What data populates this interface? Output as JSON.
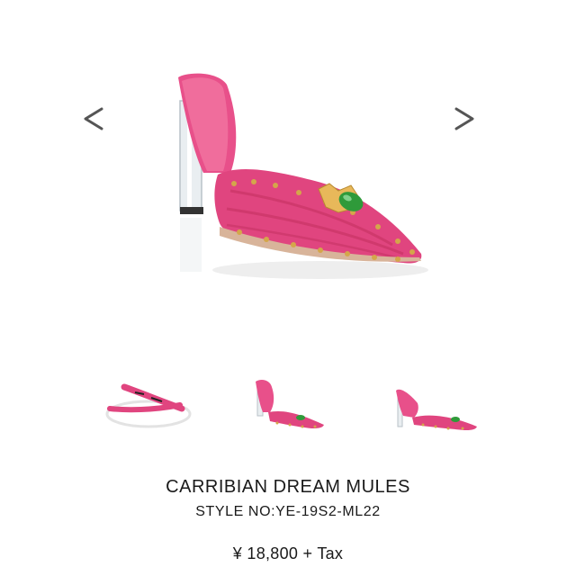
{
  "gallery": {
    "prev_icon": "chevron-left-icon",
    "next_icon": "chevron-right-icon",
    "main_image": "pink-mule-shoe",
    "thumbnails": [
      "wristband-thumbnail",
      "pink-mule-side-thumbnail",
      "pink-mule-angle-thumbnail"
    ]
  },
  "product": {
    "name": "CARRIBIAN DREAM MULES",
    "style_no": "STYLE NO:YE-19S2-ML22",
    "price": "¥ 18,800 + Tax"
  },
  "colors": {
    "shoe_pink": "#e0457f",
    "shoe_pink_dark": "#c2305f",
    "gem_green": "#2f9a3a",
    "stud_gold": "#d4a64a",
    "text": "#1a1a1a"
  }
}
